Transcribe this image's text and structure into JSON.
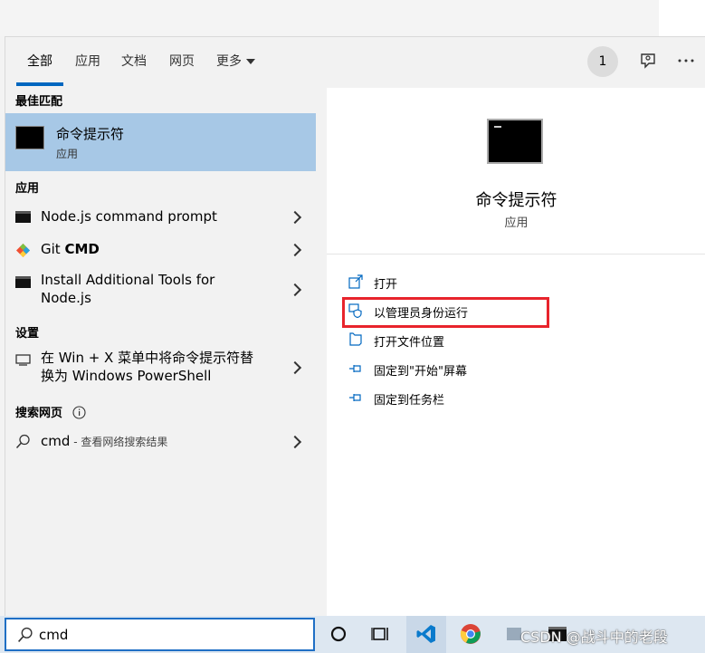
{
  "tabs": [
    {
      "label": "全部"
    },
    {
      "label": "应用"
    },
    {
      "label": "文档"
    },
    {
      "label": "网页"
    },
    {
      "label": "更多"
    }
  ],
  "header": {
    "badge_count": "1"
  },
  "left": {
    "best_match_title": "最佳匹配",
    "best_match": {
      "title": "命令提示符",
      "subtitle": "应用"
    },
    "apps_title": "应用",
    "apps": [
      {
        "label": "Node.js command prompt"
      },
      {
        "label_prefix": "Git ",
        "label_bold": "CMD"
      },
      {
        "label_line1": "Install Additional Tools for",
        "label_line2": "Node.js"
      }
    ],
    "settings_title": "设置",
    "settings": [
      {
        "label_line1": "在 Win + X 菜单中将命令提示符替",
        "label_line2": "换为 Windows PowerShell"
      }
    ],
    "web_title": "搜索网页",
    "web": {
      "query": "cmd",
      "hint": " - 查看网络搜索结果"
    }
  },
  "right": {
    "title": "命令提示符",
    "subtitle": "应用",
    "actions": [
      {
        "label": "打开"
      },
      {
        "label": "以管理员身份运行"
      },
      {
        "label": "打开文件位置"
      },
      {
        "label": "固定到\"开始\"屏幕"
      },
      {
        "label": "固定到任务栏"
      }
    ]
  },
  "search": {
    "value": "cmd"
  },
  "watermark": "CSDN @战斗中的老段",
  "colors": {
    "accent": "#0067c0",
    "highlight_border": "#e8242c",
    "best_match_bg": "#a7c8e6"
  }
}
